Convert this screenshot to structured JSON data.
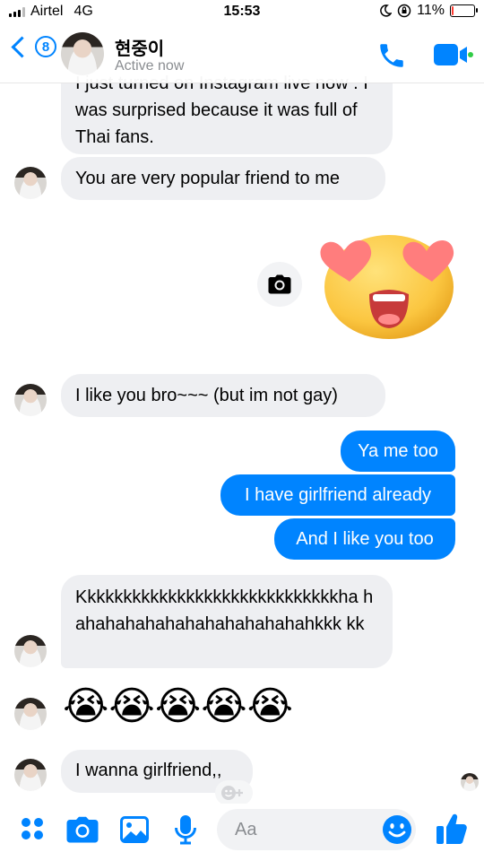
{
  "status_bar": {
    "carrier": "Airtel",
    "network": "4G",
    "time": "15:53",
    "battery_percent": "11%",
    "battery_level": 0.11
  },
  "header": {
    "back_badge_count": "8",
    "contact_name": "현중이",
    "contact_status": "Active now",
    "icons": [
      "back-chevron-icon",
      "phone-icon",
      "video-camera-icon"
    ]
  },
  "messages": [
    {
      "from": "them",
      "text": "I just turned on Instagram live now . I was surprised because it was full of Thai fans."
    },
    {
      "from": "them",
      "text": "You are very popular friend to me"
    },
    {
      "from": "me",
      "type": "sticker",
      "icon": "heart-eyes-emoji-sticker"
    },
    {
      "from": "them",
      "text": "I like you bro~~~ (but im not gay)"
    },
    {
      "from": "me",
      "text": "Ya me too"
    },
    {
      "from": "me",
      "text": "I have girlfriend already"
    },
    {
      "from": "me",
      "text": "And I like you too"
    },
    {
      "from": "them",
      "text": "Kkkkkkkkkkkkkkkkkkkkkkkkkkkkkha hahahahahahahahahahahahahkkk kk"
    },
    {
      "from": "them",
      "type": "emoji",
      "text": "😭😭😭😭😭",
      "icon": "loudly-crying-face-emoji"
    },
    {
      "from": "them",
      "text": "I wanna girlfriend,,"
    }
  ],
  "composer": {
    "placeholder": "Aa",
    "icons": [
      "apps-dots-icon",
      "camera-icon",
      "photo-gallery-icon",
      "microphone-icon",
      "emoji-smile-icon",
      "thumbs-up-icon"
    ]
  },
  "colors": {
    "messenger_blue": "#0084ff",
    "incoming_bubble": "#eeeff2",
    "outgoing_text": "#ffffff",
    "muted_text": "#8a8d91"
  }
}
